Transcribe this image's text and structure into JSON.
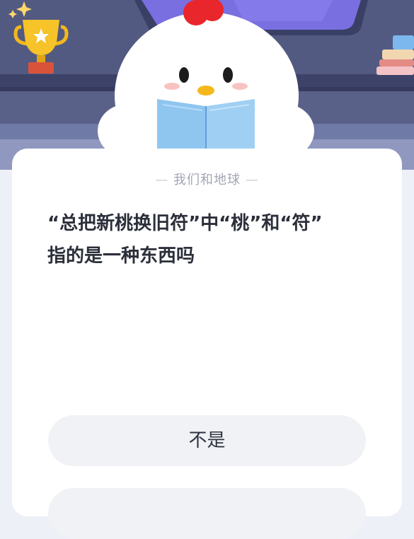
{
  "category": {
    "dash_left": "—",
    "label": "我们和地球",
    "dash_right": "—"
  },
  "question": {
    "line1": "“总把新桃换旧符”中“桃”和“符”",
    "line2": "指的是一种东西吗"
  },
  "answers": [
    {
      "label": "不是"
    },
    {
      "label": ""
    }
  ],
  "icons": [
    "sparkle-icon",
    "trophy-icon",
    "chicken-mascot",
    "book-icon",
    "stacked-books-icon"
  ],
  "colors": {
    "scene_bg": "#565d83",
    "shelf": "#3f456c",
    "card_bg": "#ffffff",
    "answer_bg": "#f1f2f6",
    "mascot_comb": "#e8262b",
    "book": "#8fc6f0"
  }
}
